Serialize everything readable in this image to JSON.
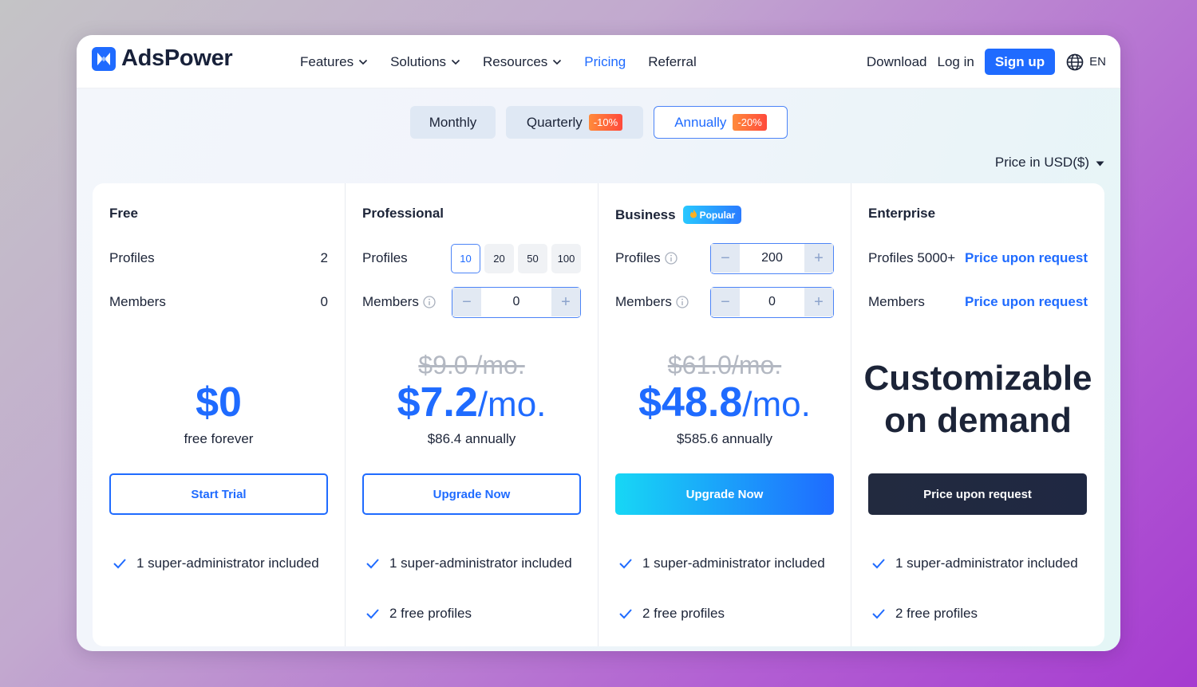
{
  "brand": {
    "name": "AdsPower",
    "color": "#1f6bff"
  },
  "nav": {
    "items": [
      {
        "label": "Features",
        "dropdown": true,
        "active": false
      },
      {
        "label": "Solutions",
        "dropdown": true,
        "active": false
      },
      {
        "label": "Resources",
        "dropdown": true,
        "active": false
      },
      {
        "label": "Pricing",
        "dropdown": false,
        "active": true
      },
      {
        "label": "Referral",
        "dropdown": false,
        "active": false
      }
    ],
    "download": "Download",
    "login": "Log in",
    "signup": "Sign up",
    "language": "EN"
  },
  "billing": {
    "options": [
      {
        "label": "Monthly",
        "discount": ""
      },
      {
        "label": "Quarterly",
        "discount": "-10%"
      },
      {
        "label": "Annually",
        "discount": "-20%"
      }
    ],
    "selected": "Annually"
  },
  "currency": "Price in USD($)",
  "plans": [
    {
      "name": "Free",
      "profiles_label": "Profiles",
      "profiles_value": "2",
      "members_label": "Members",
      "members_value": "0",
      "price": "$0",
      "price_sub": "free forever",
      "cta": "Start Trial",
      "features": [
        "1 super-administrator included"
      ]
    },
    {
      "name": "Professional",
      "profiles_label": "Profiles",
      "profile_options": [
        "10",
        "20",
        "50",
        "100"
      ],
      "profile_selected": "10",
      "members_label": "Members",
      "members_value": "0",
      "old_price": "$9.0 /mo.",
      "price": "$7.2",
      "price_unit": "/mo.",
      "price_sub": "$86.4 annually",
      "cta": "Upgrade Now",
      "features": [
        "1 super-administrator included",
        "2 free profiles"
      ]
    },
    {
      "name": "Business",
      "badge": "Popular",
      "profiles_label": "Profiles",
      "profiles_value": "200",
      "members_label": "Members",
      "members_value": "0",
      "old_price": "$61.0/mo.",
      "price": "$48.8",
      "price_unit": "/mo.",
      "price_sub": "$585.6 annually",
      "cta": "Upgrade Now",
      "features": [
        "1 super-administrator included",
        "2 free profiles"
      ]
    },
    {
      "name": "Enterprise",
      "profiles_label": "Profiles 5000+",
      "profiles_value": "Price upon request",
      "members_label": "Members",
      "members_value": "Price upon request",
      "price_line1": "Customizable",
      "price_line2": "on demand",
      "cta": "Price upon request",
      "features": [
        "1 super-administrator included",
        "2 free profiles"
      ]
    }
  ],
  "icons": [
    "adspower-logo-icon",
    "chevron-down-icon",
    "globe-icon",
    "caret-down-icon",
    "info-icon",
    "check-icon",
    "fire-icon",
    "minus-icon",
    "plus-icon"
  ],
  "colors": {
    "accent": "#1f6bff",
    "badge_orange": "#ff5a3b",
    "dark_button": "#222a3f",
    "text": "#1c2438"
  }
}
